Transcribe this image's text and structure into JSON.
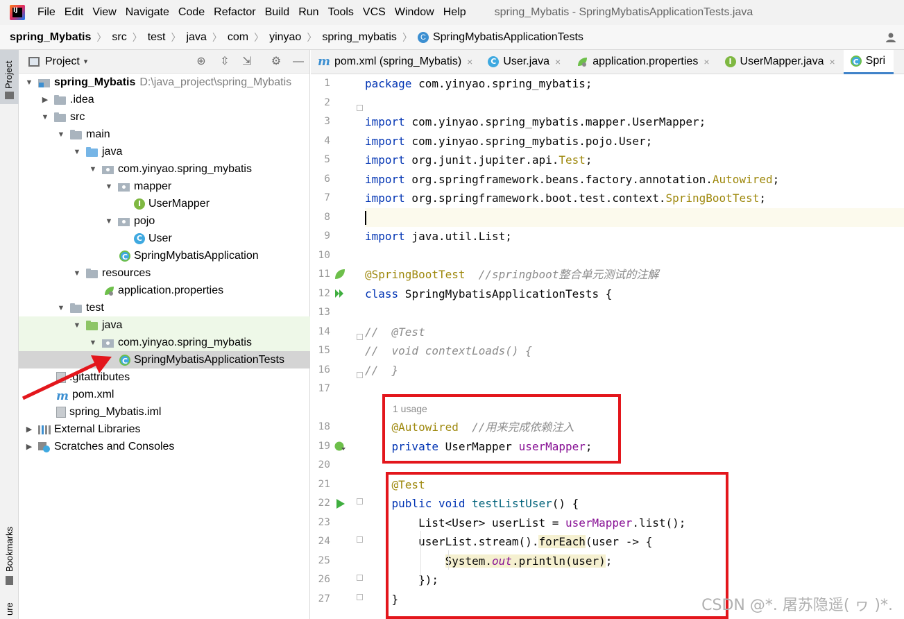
{
  "menubar": {
    "items": [
      {
        "label": "File"
      },
      {
        "label": "Edit"
      },
      {
        "label": "View"
      },
      {
        "label": "Navigate"
      },
      {
        "label": "Code"
      },
      {
        "label": "Refactor"
      },
      {
        "label": "Build"
      },
      {
        "label": "Run"
      },
      {
        "label": "Tools"
      },
      {
        "label": "VCS"
      },
      {
        "label": "Window"
      },
      {
        "label": "Help"
      }
    ],
    "window_title": "spring_Mybatis - SpringMybatisApplicationTests.java"
  },
  "breadcrumb": [
    "spring_Mybatis",
    "src",
    "test",
    "java",
    "com",
    "yinyao",
    "spring_mybatis",
    "SpringMybatisApplicationTests"
  ],
  "left_strip": {
    "project": "Project",
    "bookmarks": "Bookmarks",
    "structure": "ure"
  },
  "project_panel": {
    "title": "Project",
    "tree": [
      {
        "label": "spring_Mybatis",
        "path": "D:\\java_project\\spring_Mybatis"
      },
      {
        "label": ".idea"
      },
      {
        "label": "src"
      },
      {
        "label": "main"
      },
      {
        "label": "java"
      },
      {
        "label": "com.yinyao.spring_mybatis"
      },
      {
        "label": "mapper"
      },
      {
        "label": "UserMapper"
      },
      {
        "label": "pojo"
      },
      {
        "label": "User"
      },
      {
        "label": "SpringMybatisApplication"
      },
      {
        "label": "resources"
      },
      {
        "label": "application.properties"
      },
      {
        "label": "test"
      },
      {
        "label": "java"
      },
      {
        "label": "com.yinyao.spring_mybatis"
      },
      {
        "label": "SpringMybatisApplicationTests"
      },
      {
        "label": ".gitattributes"
      },
      {
        "label": "pom.xml"
      },
      {
        "label": "spring_Mybatis.iml"
      },
      {
        "label": "External Libraries"
      },
      {
        "label": "Scratches and Consoles"
      }
    ]
  },
  "tabs": [
    {
      "label": "pom.xml (spring_Mybatis)"
    },
    {
      "label": "User.java"
    },
    {
      "label": "application.properties"
    },
    {
      "label": "UserMapper.java"
    },
    {
      "label": "Spri"
    }
  ],
  "editor": {
    "line_numbers": [
      "1",
      "2",
      "3",
      "4",
      "5",
      "6",
      "7",
      "8",
      "9",
      "10",
      "11",
      "12",
      "13",
      "14",
      "15",
      "16",
      "17",
      "18",
      "19",
      "20",
      "21",
      "22",
      "23",
      "24",
      "25",
      "26",
      "27"
    ],
    "code": {
      "l1_kw": "package",
      "l1_rest": " com.yinyao.spring_mybatis;",
      "import_kw": "import",
      "l3_rest": " com.yinyao.spring_mybatis.mapper.UserMapper;",
      "l4_rest": " com.yinyao.spring_mybatis.pojo.User;",
      "l5_a": " org.junit.jupiter.api.",
      "l5_b": "Test",
      "l5_c": ";",
      "l6_a": " org.springframework.beans.factory.annotation.",
      "l6_b": "Autowired",
      "l6_c": ";",
      "l7_a": " org.springframework.boot.test.context.",
      "l7_b": "SpringBootTest",
      "l7_c": ";",
      "l9_rest": " java.util.List;",
      "l11_ann": "@SpringBootTest",
      "l11_cmt": "  //springboot整合单元测试的注解",
      "l12_kw": "class",
      "l12_rest": " SpringMybatisApplicationTests {",
      "l14": "//  @Test",
      "l15": "//  void contextLoads() {",
      "l16": "//  }",
      "usage_hint": "1 usage",
      "l18_ann": "@Autowired",
      "l18_cmt": "  //用来完成依赖注入",
      "l19_kw": "private",
      "l19_type": " UserMapper ",
      "l19_fld": "userMapper",
      "l19_end": ";",
      "l21_ann": "@Test",
      "l22_kw1": "public",
      "l22_kw2": "void",
      "l22_fn": "testListUser",
      "l22_end": "() {",
      "l23_a": "List<User> userList = ",
      "l23_fld": "userMapper",
      "l23_b": ".list();",
      "l24_a": "userList.stream().",
      "l24_fn": "forEach",
      "l24_b": "(user -> {",
      "l25_a": "System.",
      "l25_fld": "out",
      "l25_b": ".println(user)",
      "l25_c": ";",
      "l26": "});",
      "l27": "}"
    }
  },
  "watermark": "CSDN @*. 屠苏隐遥( ヮ )*.",
  "colors": {
    "annotation_box": "#e3161c",
    "keyword": "#0033b3",
    "annotation": "#9e880d",
    "field": "#871094"
  }
}
